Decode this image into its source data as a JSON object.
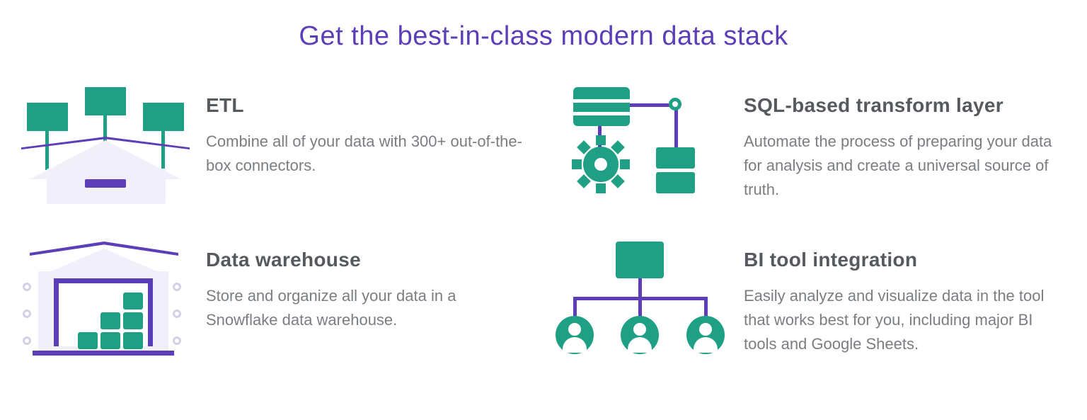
{
  "headline": "Get the best-in-class modern data stack",
  "features": [
    {
      "icon": "etl-icon",
      "title": "ETL",
      "body": "Combine all of your data with 300+ out-of-the-box connectors."
    },
    {
      "icon": "sql-transform-icon",
      "title": "SQL-based transform layer",
      "body": "Automate the process of preparing your data for analysis and create a universal source of truth."
    },
    {
      "icon": "data-warehouse-icon",
      "title": "Data warehouse",
      "body": "Store and organize all your data in a Snowflake data warehouse."
    },
    {
      "icon": "bi-tool-icon",
      "title": "BI tool integration",
      "body": "Easily analyze and visualize data in the tool that works best for you, including major BI tools and Google Sheets."
    }
  ]
}
